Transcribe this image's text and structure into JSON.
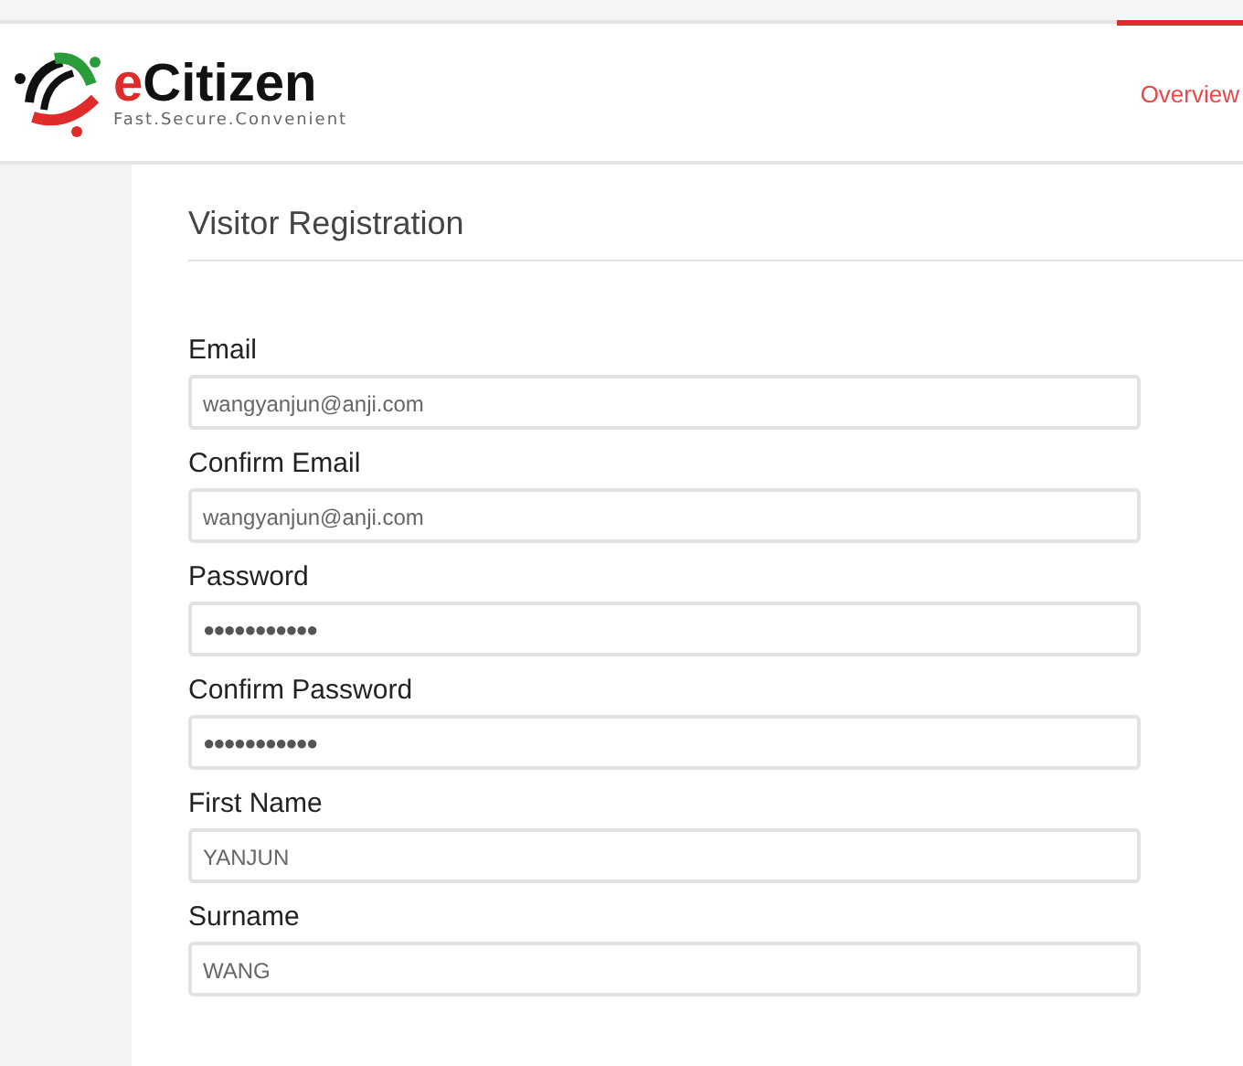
{
  "header": {
    "brand": "eCitizen",
    "tagline": "Fast.Secure.Convenient"
  },
  "nav": [
    {
      "label": "Overview",
      "selected": true
    }
  ],
  "form": {
    "title": "Visitor Registration",
    "fields": [
      {
        "label": "Email",
        "value": "wangyanjun@anji.com",
        "kind": "text"
      },
      {
        "label": "Confirm Email",
        "value": "wangyanjun@anji.com",
        "kind": "text"
      },
      {
        "label": "Password",
        "value": "●●●●●●●●●●●",
        "kind": "password"
      },
      {
        "label": "Confirm Password",
        "value": "●●●●●●●●●●●",
        "kind": "password"
      },
      {
        "label": "First Name",
        "value": "YANJUN",
        "kind": "text"
      },
      {
        "label": "Surname",
        "value": "WANG",
        "kind": "text"
      }
    ]
  }
}
